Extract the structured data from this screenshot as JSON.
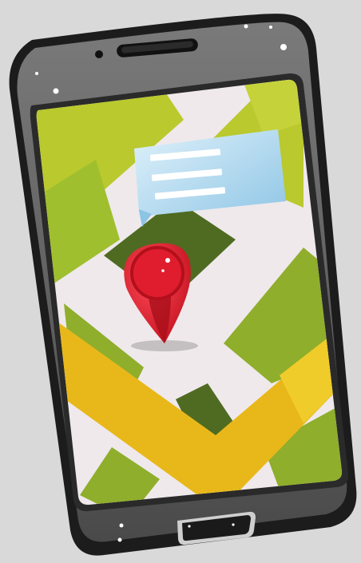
{
  "illustration": {
    "subject": "smartphone-map-location",
    "icons": [
      "location-pin-icon",
      "message-bubble-icon",
      "home-button-icon"
    ],
    "colors": {
      "background": "#d9d9d9",
      "phone_body": "#1f1f1f",
      "phone_bezel_top": "#6e6e6e",
      "map_base": "#efe9ec",
      "map_green_light": "#b9c92e",
      "map_green_mid": "#8fae2c",
      "map_green_dark": "#4f6b21",
      "road_yellow": "#e8b81a",
      "pin_red": "#e01d2e",
      "bubble_blue": "#a9d6ee"
    }
  }
}
